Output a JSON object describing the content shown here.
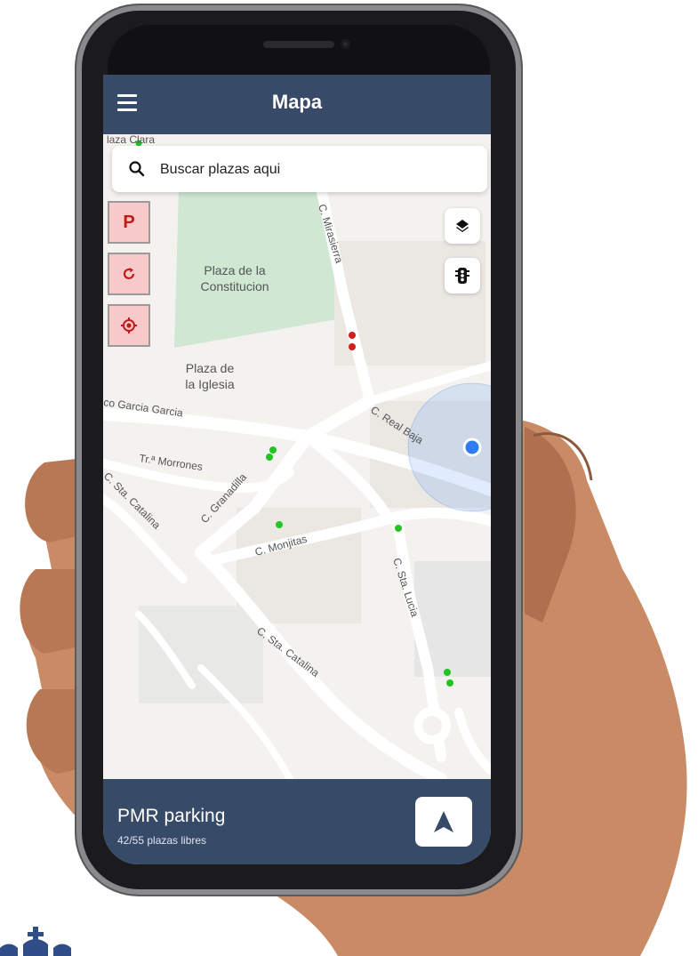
{
  "app": {
    "title": "Mapa"
  },
  "search": {
    "placeholder": "Buscar plazas aqui"
  },
  "side_buttons": {
    "parking_label": "P"
  },
  "map_labels": {
    "plaza_clara_partial": "laza Clara",
    "plaza_constitucion": [
      "Plaza de la",
      "Constitucion"
    ],
    "plaza_iglesia": [
      "Plaza de",
      "la Iglesia"
    ],
    "c_mirasierra": "C. Mirasierra",
    "c_real_baja": "C. Real Baja",
    "garcia_garcia": "co Garcia Garcia",
    "tr_morrones": "Tr.ª Morrones",
    "c_sta_catalina_upper": "C. Sta. Catalina",
    "c_granadilla": "C. Granadilla",
    "c_monjitas": "C. Monjitas",
    "c_sta_lucia": "C. Sta. Lucia",
    "c_sta_catalina_lower": "C. Sta. Catalina"
  },
  "parking_status_colors": {
    "free": "#22c422",
    "occupied": "#d11f1f"
  },
  "bottom_bar": {
    "title": "PMR parking",
    "subtitle": "42/55 plazas libres"
  },
  "colors": {
    "appbar": "#374a67",
    "side_button_bg": "#f7c9c9",
    "location": "#2f7df0"
  }
}
